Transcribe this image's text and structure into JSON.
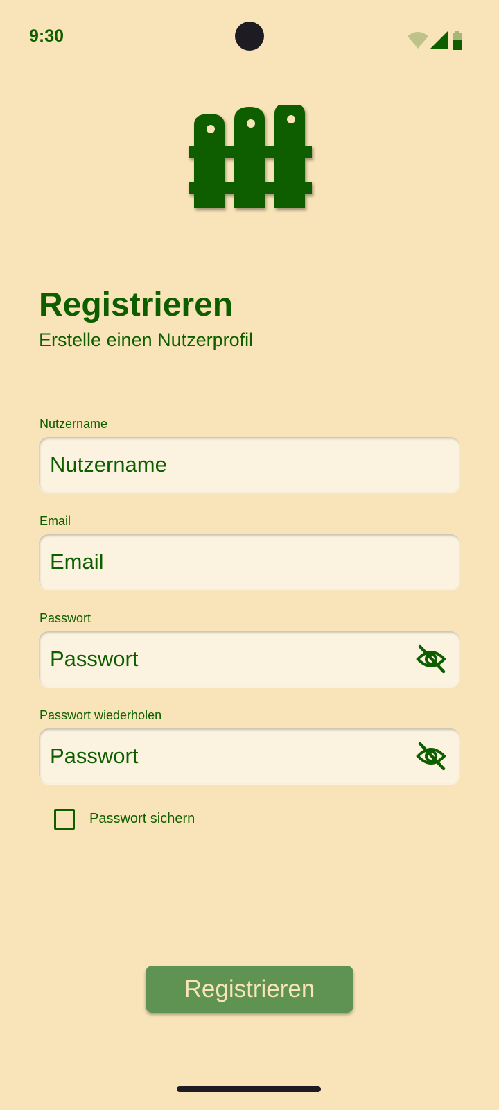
{
  "status_bar": {
    "time": "9:30",
    "icons": [
      "wifi-icon",
      "signal-icon",
      "battery-icon"
    ]
  },
  "logo": {
    "icon": "fence-icon"
  },
  "header": {
    "title": "Registrieren",
    "subtitle": "Erstelle einen Nutzerprofil"
  },
  "form": {
    "username": {
      "label": "Nutzername",
      "placeholder": "Nutzername",
      "value": ""
    },
    "email": {
      "label": "Email",
      "placeholder": "Email",
      "value": ""
    },
    "password": {
      "label": "Passwort",
      "placeholder": "Passwort",
      "value": "",
      "toggle_icon": "eye-off-icon"
    },
    "password_repeat": {
      "label": "Passwort wiederholen",
      "placeholder": "Passwort",
      "value": "",
      "toggle_icon": "eye-off-icon"
    },
    "save_password": {
      "label": "Passwort sichern",
      "checked": false
    }
  },
  "actions": {
    "register_label": "Registrieren"
  },
  "colors": {
    "background": "#F8E4B8",
    "primary": "#0E5E00",
    "field_background": "#FBF2E0",
    "button": "#5E9353",
    "button_text": "#F8E4B8"
  }
}
